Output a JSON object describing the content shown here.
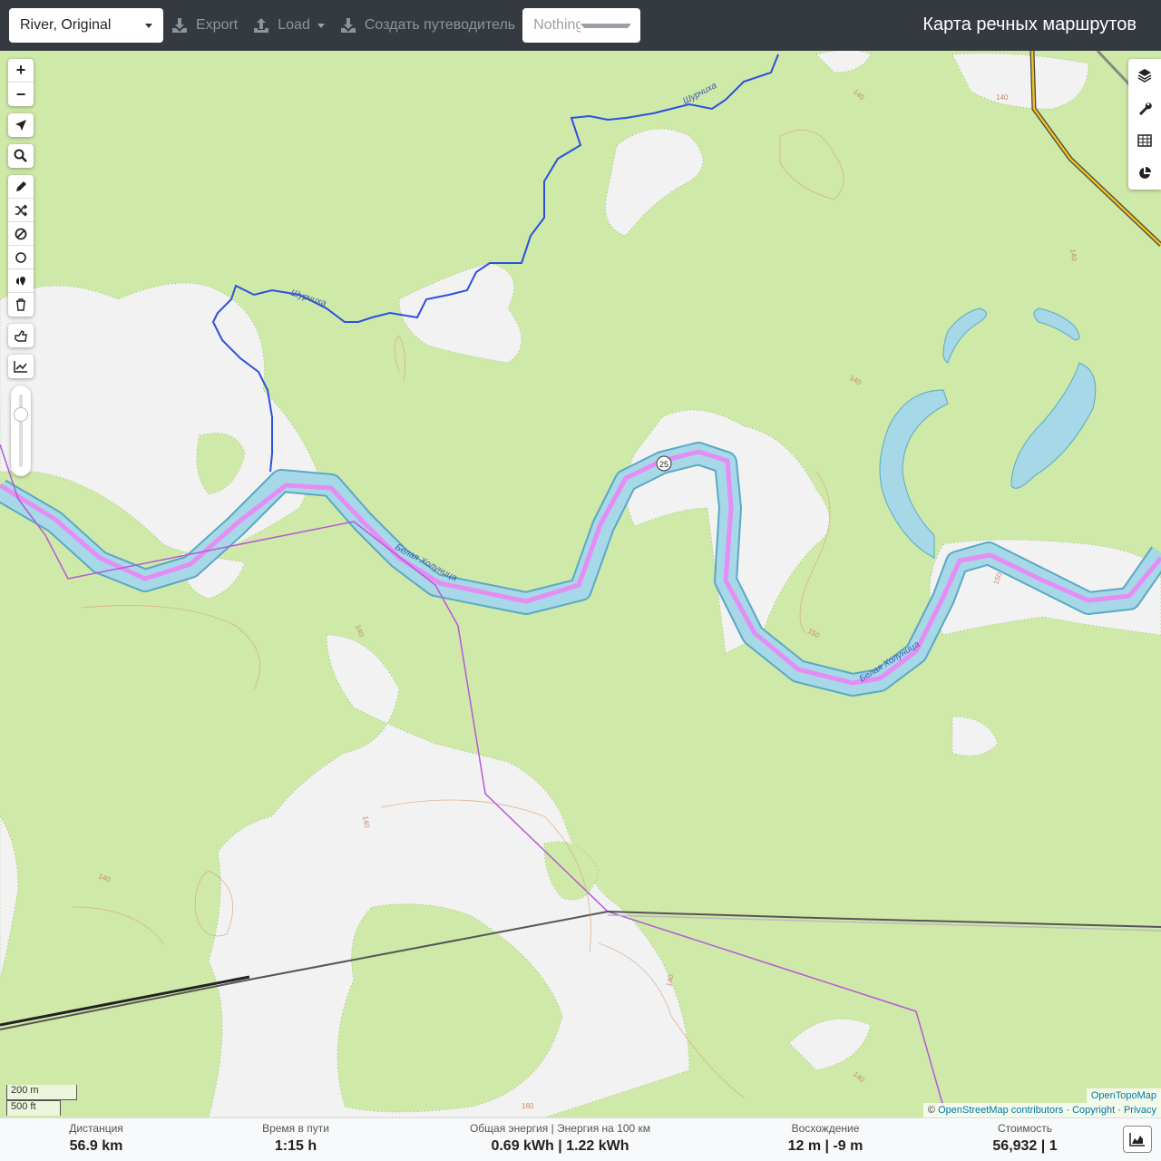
{
  "header": {
    "profile_select": "River, Original",
    "export_label": "Export",
    "load_label": "Load",
    "guide_label": "Создать путеводитель",
    "nothing_selected": "Nothing selected",
    "app_title": "Карта речных маршрутов"
  },
  "map": {
    "river_label_1": "Белая Холуница",
    "river_label_2": "Белая Холуница",
    "stream_label_1": "Шурчиха",
    "stream_label_2": "Шурчиха",
    "route_marker": "25",
    "contour_labels": [
      "140",
      "140",
      "140",
      "140",
      "140",
      "140",
      "140",
      "140",
      "140",
      "150",
      "150",
      "160"
    ],
    "colors": {
      "forest": "#cfe9a8",
      "clearing": "#f3f3f3",
      "water": "#a6d8e8",
      "stream": "#2d4fe0",
      "route": "#e58cf5",
      "boundary": "#b45ad6",
      "railway": "#555555",
      "road": "#f2c21b"
    }
  },
  "map_controls": {
    "zoom_in": "+",
    "zoom_out": "−"
  },
  "scale": {
    "metric": "200 m",
    "imperial": "500 ft"
  },
  "attribution": {
    "tiles": "OpenTopoMap",
    "copyright_symbol": "©",
    "osm": "OpenStreetMap contributors",
    "sep1": "·",
    "copyright": "Copyright",
    "sep2": "·",
    "privacy": "Privacy"
  },
  "footer": {
    "distance_label": "Дистанция",
    "distance_value": "56.9 km",
    "time_label": "Время в пути",
    "time_value": "1:15 h",
    "energy_label": "Общая энергия | Энергия на 100 км",
    "energy_value": "0.69 kWh | 1.22 kWh",
    "ascent_label": "Восхождение",
    "ascent_value": "12 m | -9 m",
    "cost_label": "Стоимость",
    "cost_value": "56,932 | 1"
  }
}
